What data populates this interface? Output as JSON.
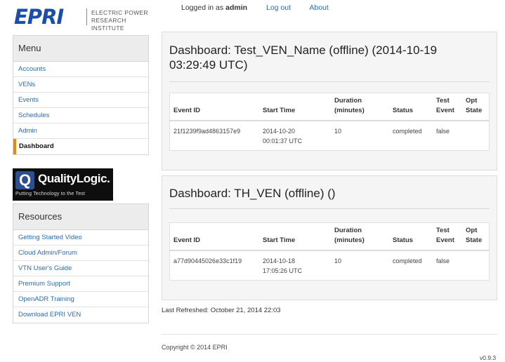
{
  "logo": {
    "brand": "EPRI",
    "line1": "ELECTRIC POWER",
    "line2": "RESEARCH INSTITUTE"
  },
  "topnav": {
    "logged_in_prefix": "Logged in as",
    "username": "admin",
    "logout": "Log out",
    "about": "About"
  },
  "menu": {
    "title": "Menu",
    "items": [
      {
        "label": "Accounts"
      },
      {
        "label": "VENs"
      },
      {
        "label": "Events"
      },
      {
        "label": "Schedules"
      },
      {
        "label": "Admin"
      },
      {
        "label": "Dashboard"
      }
    ]
  },
  "quality_logic": {
    "mark": "Q",
    "name": "QualityLogic.",
    "tagline": "Putting Technology to the Test"
  },
  "resources": {
    "title": "Resources",
    "items": [
      {
        "label": "Getting Started Video"
      },
      {
        "label": "Cloud Admin/Forum"
      },
      {
        "label": "VTN User's Guide"
      },
      {
        "label": "Premium Support"
      },
      {
        "label": "OpenADR Training"
      },
      {
        "label": "Download EPRI VEN"
      }
    ]
  },
  "columns": {
    "event_id": "Event ID",
    "start_time": "Start Time",
    "duration_1": "Duration",
    "duration_2": "(minutes)",
    "status": "Status",
    "test_1": "Test",
    "test_2": "Event",
    "opt_1": "Opt",
    "opt_2": "State"
  },
  "dashboards": [
    {
      "title_line1": "Dashboard: Test_VEN_Name (offline) (2014-10-19",
      "title_line2": "03:29:49 UTC)",
      "rows": [
        {
          "event_id": "21f1239f9ad4863157e9",
          "start_1": "2014-10-20",
          "start_2": "00:01:37 UTC",
          "duration": "10",
          "status": "completed",
          "test_event": "false",
          "opt_state": ""
        }
      ]
    },
    {
      "title_line1": "Dashboard: TH_VEN (offline) ()",
      "title_line2": "",
      "rows": [
        {
          "event_id": "a77d90445026e33c1f19",
          "start_1": "2014-10-18",
          "start_2": "17:05:26 UTC",
          "duration": "10",
          "status": "completed",
          "test_event": "false",
          "opt_state": ""
        }
      ]
    }
  ],
  "refresh": {
    "label": "Last Refreshed:",
    "value": "October 21, 2014 22:03"
  },
  "footer": {
    "copyright": "Copyright © 2014 EPRI",
    "version": "v0.9.3"
  },
  "colors": {
    "brand_blue": "#1c4ea8",
    "link": "#2a6db0",
    "active_accent": "#e08a10"
  }
}
